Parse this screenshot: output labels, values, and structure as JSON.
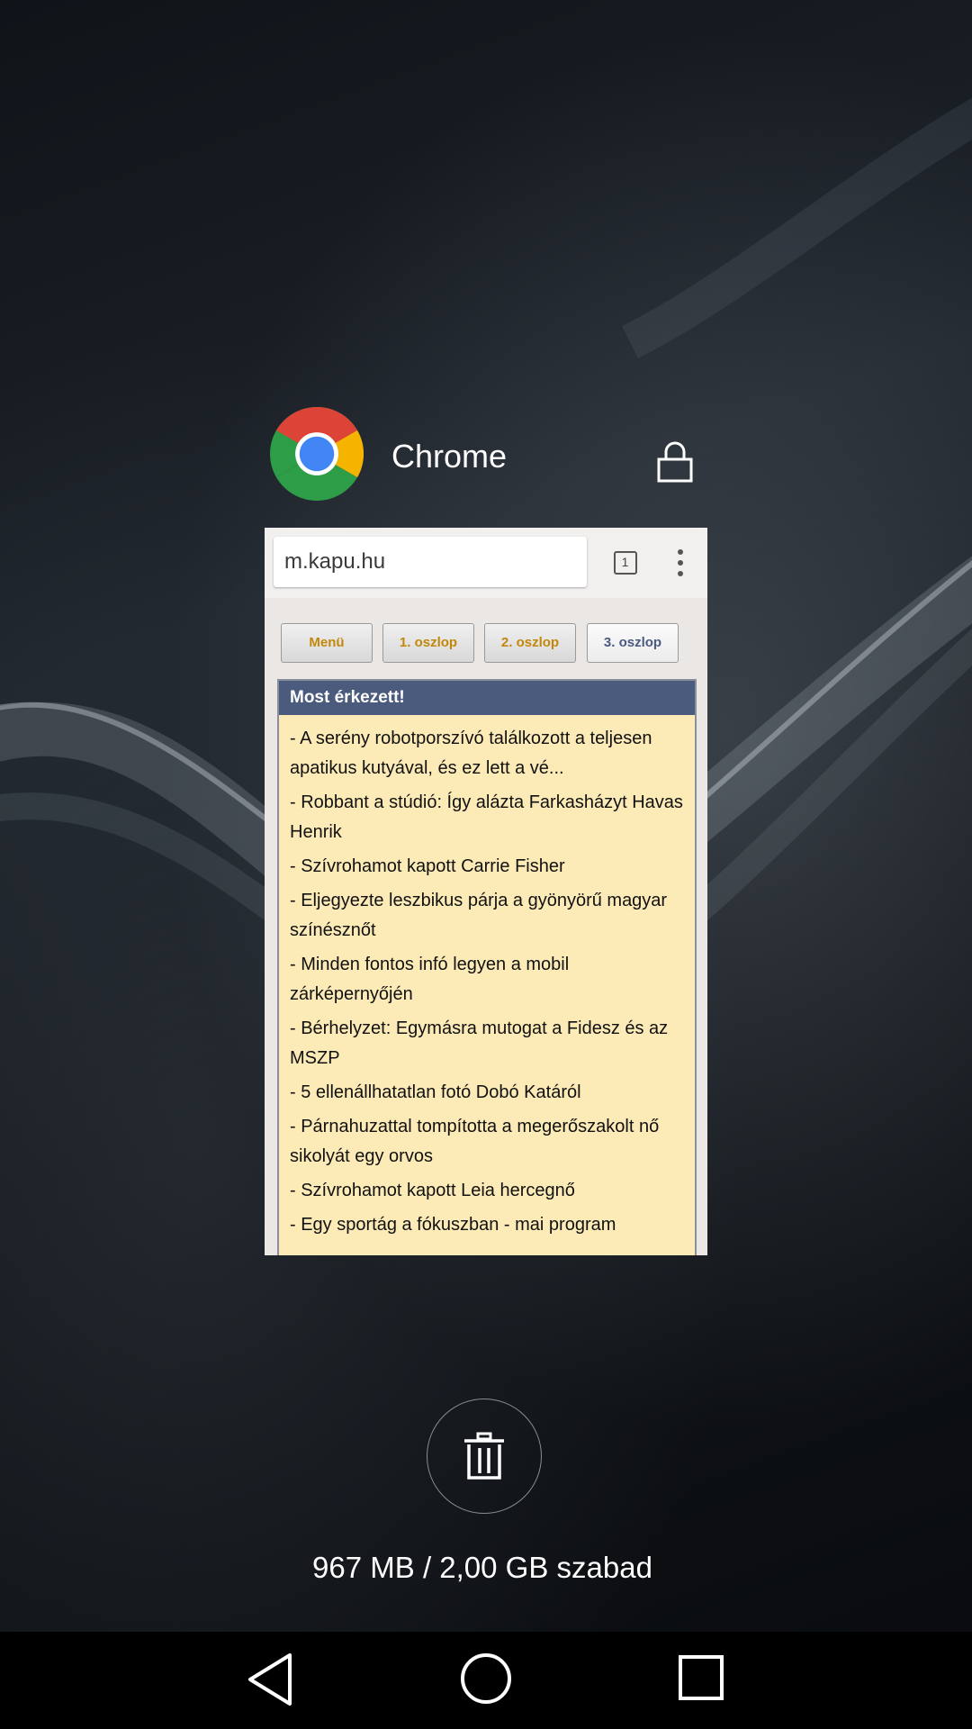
{
  "app": {
    "name": "Chrome",
    "icon": "chrome-logo-icon",
    "lock_icon": "lock-icon"
  },
  "browser": {
    "url": "m.kapu.hu",
    "tab_count": "1"
  },
  "site": {
    "nav_buttons": [
      {
        "label": "Menü"
      },
      {
        "label": "1. oszlop"
      },
      {
        "label": "2. oszlop"
      },
      {
        "label": "3. oszlop"
      }
    ],
    "news_title": "Most érkezett!",
    "news_items": [
      "- A serény robotporszívó találkozott a teljesen apatikus kutyával, és ez lett a vé...",
      "- Robbant a stúdió: Így alázta Farkasházyt Havas Henrik",
      "- Szívrohamot kapott Carrie Fisher",
      "- Eljegyezte leszbikus párja a gyönyörű magyar színésznőt",
      "- Minden fontos infó legyen a mobil zárképernyőjén",
      "- Bérhelyzet: Egymásra mutogat a Fidesz és az MSZP",
      "- 5 ellenállhatatlan fotó Dobó Katáról",
      "- Párnahuzattal tompította a megerőszakolt nő sikolyát egy orvos",
      "- Szívrohamot kapott Leia hercegnő",
      "- Egy sportág a fókuszban - mai program"
    ]
  },
  "memory": {
    "text": "967 MB / 2,00 GB szabad"
  },
  "colors": {
    "news_header": "#4b5b7d",
    "news_bg": "#fdebb7",
    "gold_button_text": "#c2870b",
    "active_button_text": "#4a5a82"
  }
}
